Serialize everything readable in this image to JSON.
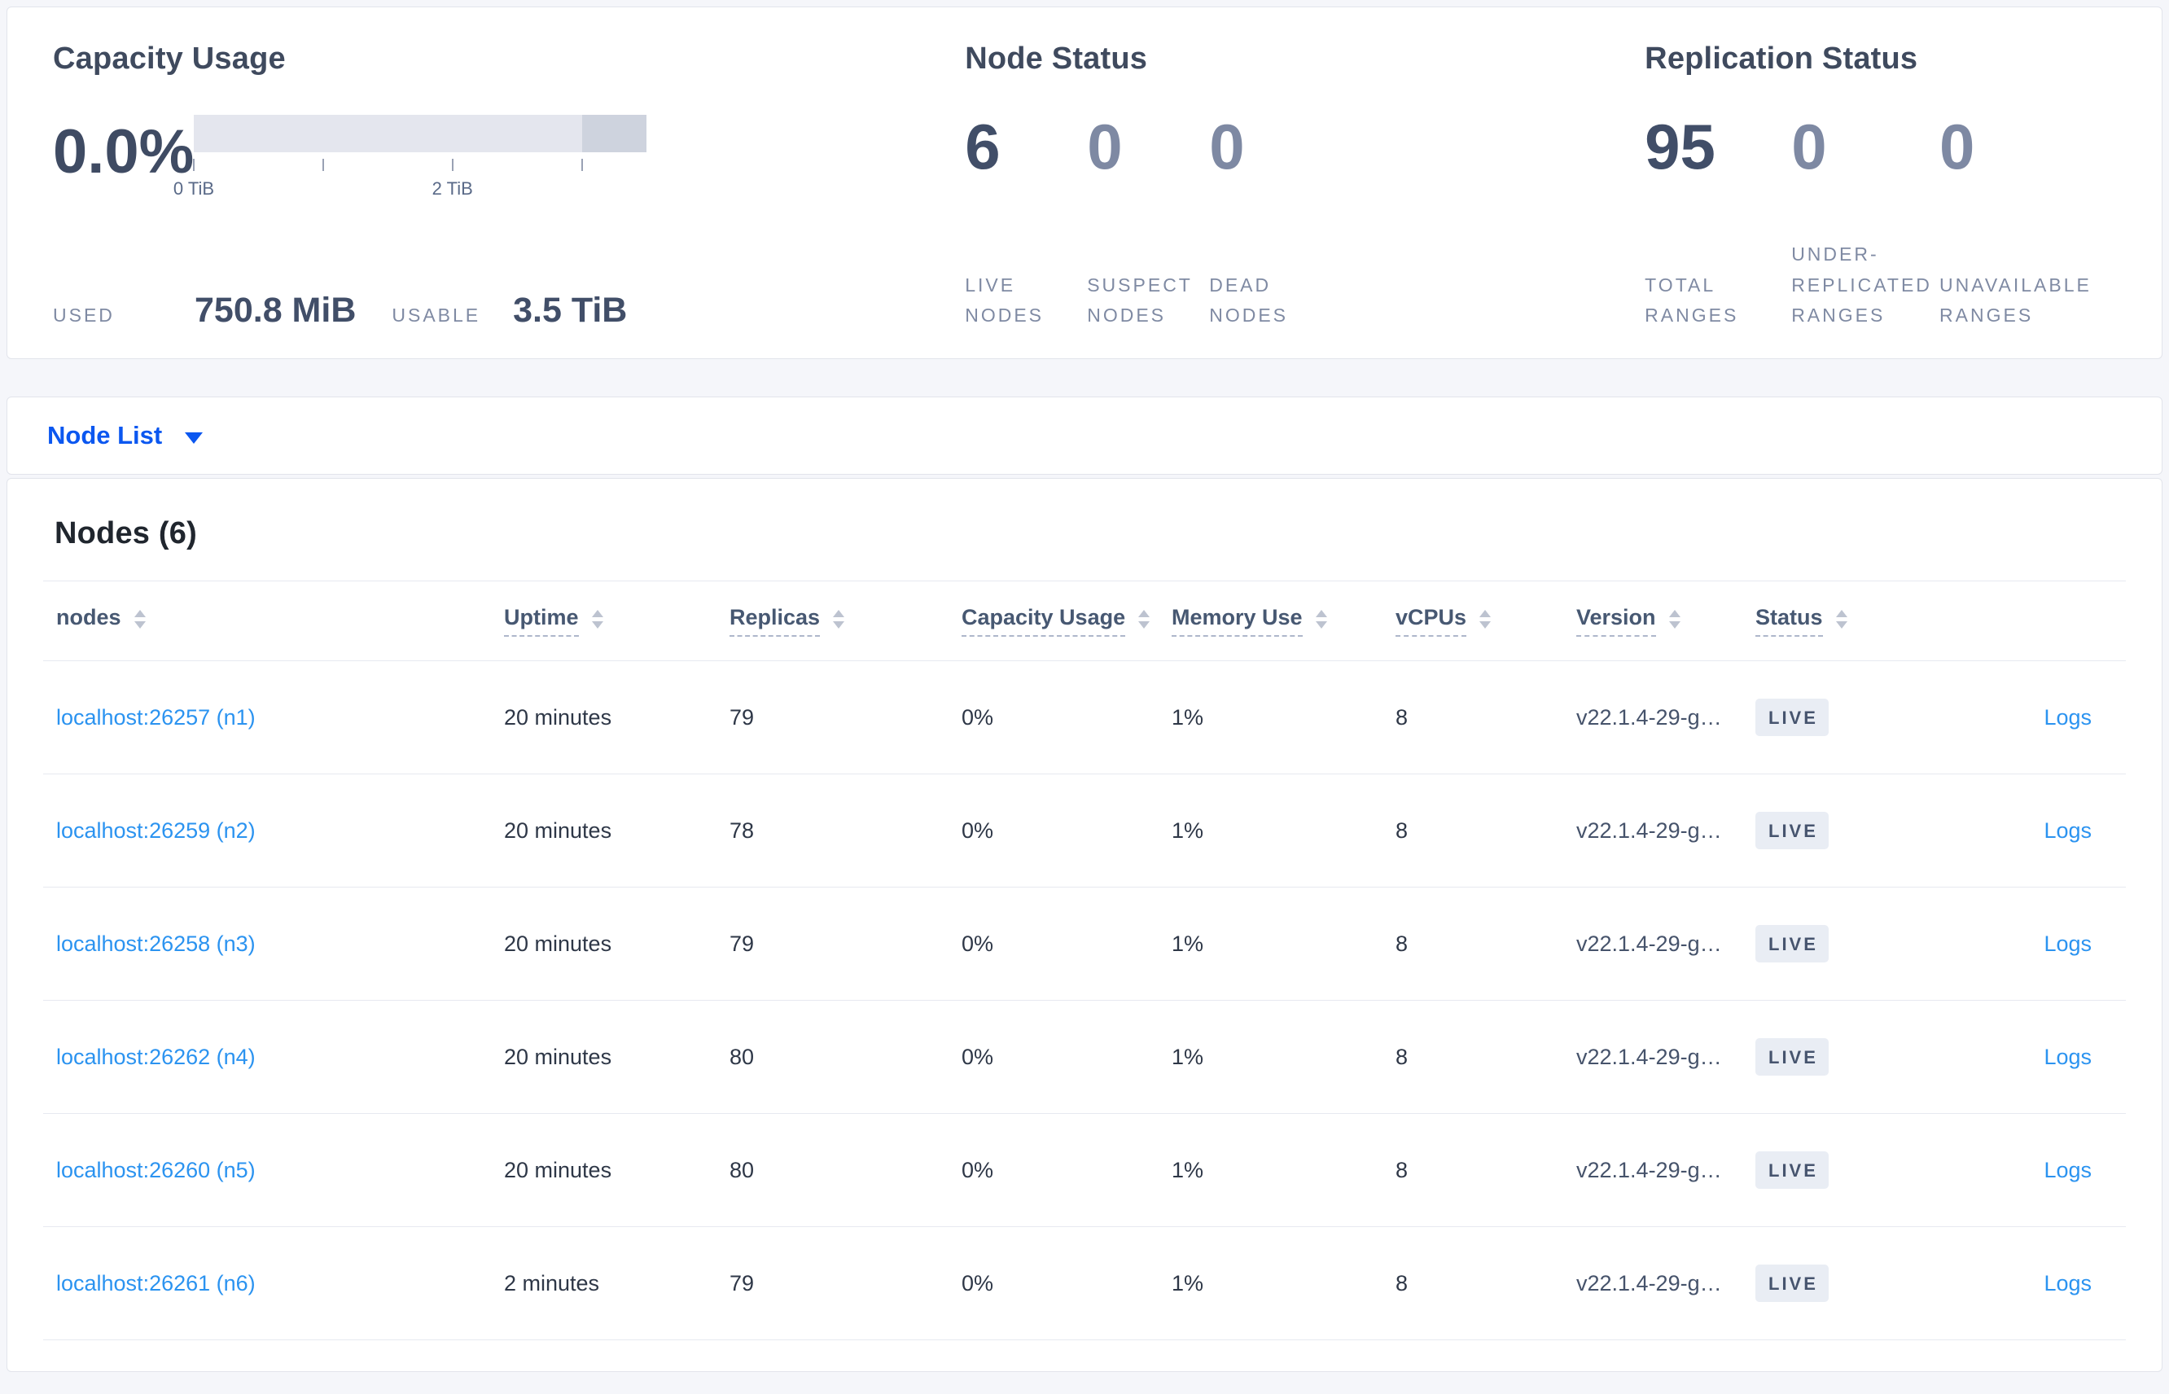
{
  "colors": {
    "primary_blue": "#0b57f0",
    "link_blue": "#2b93f0",
    "badge_bg": "#e9edf4",
    "badge_text": "#46546e",
    "bar_light": "#e4e6ee",
    "bar_dark": "#ced3de"
  },
  "summary": {
    "capacity": {
      "title": "Capacity Usage",
      "percent": "0.0%",
      "bar": {
        "max_tib": 3.5,
        "dark_from_tib": 3.0,
        "ticks": [
          {
            "tib": 0,
            "label": "0 TiB"
          },
          {
            "tib": 1,
            "label": ""
          },
          {
            "tib": 2,
            "label": "2 TiB"
          },
          {
            "tib": 3,
            "label": ""
          }
        ]
      },
      "used_label": "USED",
      "used_value": "750.8 MiB",
      "usable_label": "USABLE",
      "usable_value": "3.5 TiB"
    },
    "node_status": {
      "title": "Node Status",
      "stats": [
        {
          "value": "6",
          "label": "LIVE NODES",
          "emphasis": true
        },
        {
          "value": "0",
          "label": "SUSPECT NODES",
          "emphasis": false
        },
        {
          "value": "0",
          "label": "DEAD NODES",
          "emphasis": false
        }
      ]
    },
    "replication_status": {
      "title": "Replication Status",
      "stats": [
        {
          "value": "95",
          "label": "TOTAL RANGES",
          "emphasis": true
        },
        {
          "value": "0",
          "label": "UNDER-REPLICATED RANGES",
          "emphasis": false
        },
        {
          "value": "0",
          "label": "UNAVAILABLE RANGES",
          "emphasis": false
        }
      ]
    }
  },
  "node_list_bar": {
    "label": "Node List",
    "caret_icon": "caret-down-icon"
  },
  "nodes_table": {
    "heading": "Nodes (6)",
    "columns": [
      {
        "key": "address",
        "label": "nodes",
        "dotted": false,
        "sortable": true
      },
      {
        "key": "uptime",
        "label": "Uptime",
        "dotted": true,
        "sortable": true
      },
      {
        "key": "replicas",
        "label": "Replicas",
        "dotted": true,
        "sortable": true
      },
      {
        "key": "capacity_usage",
        "label": "Capacity Usage",
        "dotted": true,
        "sortable": true
      },
      {
        "key": "memory_use",
        "label": "Memory Use",
        "dotted": true,
        "sortable": true
      },
      {
        "key": "vcpus",
        "label": "vCPUs",
        "dotted": true,
        "sortable": true
      },
      {
        "key": "version",
        "label": "Version",
        "dotted": true,
        "sortable": true
      },
      {
        "key": "status",
        "label": "Status",
        "dotted": true,
        "sortable": true
      },
      {
        "key": "logs",
        "label": "",
        "dotted": false,
        "sortable": false
      }
    ],
    "rows": [
      {
        "address": "localhost:26257 (n1)",
        "uptime": "20 minutes",
        "replicas": "79",
        "capacity_usage": "0%",
        "memory_use": "1%",
        "vcpus": "8",
        "version": "v22.1.4-29-g…",
        "status": "LIVE",
        "logs": "Logs"
      },
      {
        "address": "localhost:26259 (n2)",
        "uptime": "20 minutes",
        "replicas": "78",
        "capacity_usage": "0%",
        "memory_use": "1%",
        "vcpus": "8",
        "version": "v22.1.4-29-g…",
        "status": "LIVE",
        "logs": "Logs"
      },
      {
        "address": "localhost:26258 (n3)",
        "uptime": "20 minutes",
        "replicas": "79",
        "capacity_usage": "0%",
        "memory_use": "1%",
        "vcpus": "8",
        "version": "v22.1.4-29-g…",
        "status": "LIVE",
        "logs": "Logs"
      },
      {
        "address": "localhost:26262 (n4)",
        "uptime": "20 minutes",
        "replicas": "80",
        "capacity_usage": "0%",
        "memory_use": "1%",
        "vcpus": "8",
        "version": "v22.1.4-29-g…",
        "status": "LIVE",
        "logs": "Logs"
      },
      {
        "address": "localhost:26260 (n5)",
        "uptime": "20 minutes",
        "replicas": "80",
        "capacity_usage": "0%",
        "memory_use": "1%",
        "vcpus": "8",
        "version": "v22.1.4-29-g…",
        "status": "LIVE",
        "logs": "Logs"
      },
      {
        "address": "localhost:26261 (n6)",
        "uptime": "2 minutes",
        "replicas": "79",
        "capacity_usage": "0%",
        "memory_use": "1%",
        "vcpus": "8",
        "version": "v22.1.4-29-g…",
        "status": "LIVE",
        "logs": "Logs"
      }
    ]
  }
}
